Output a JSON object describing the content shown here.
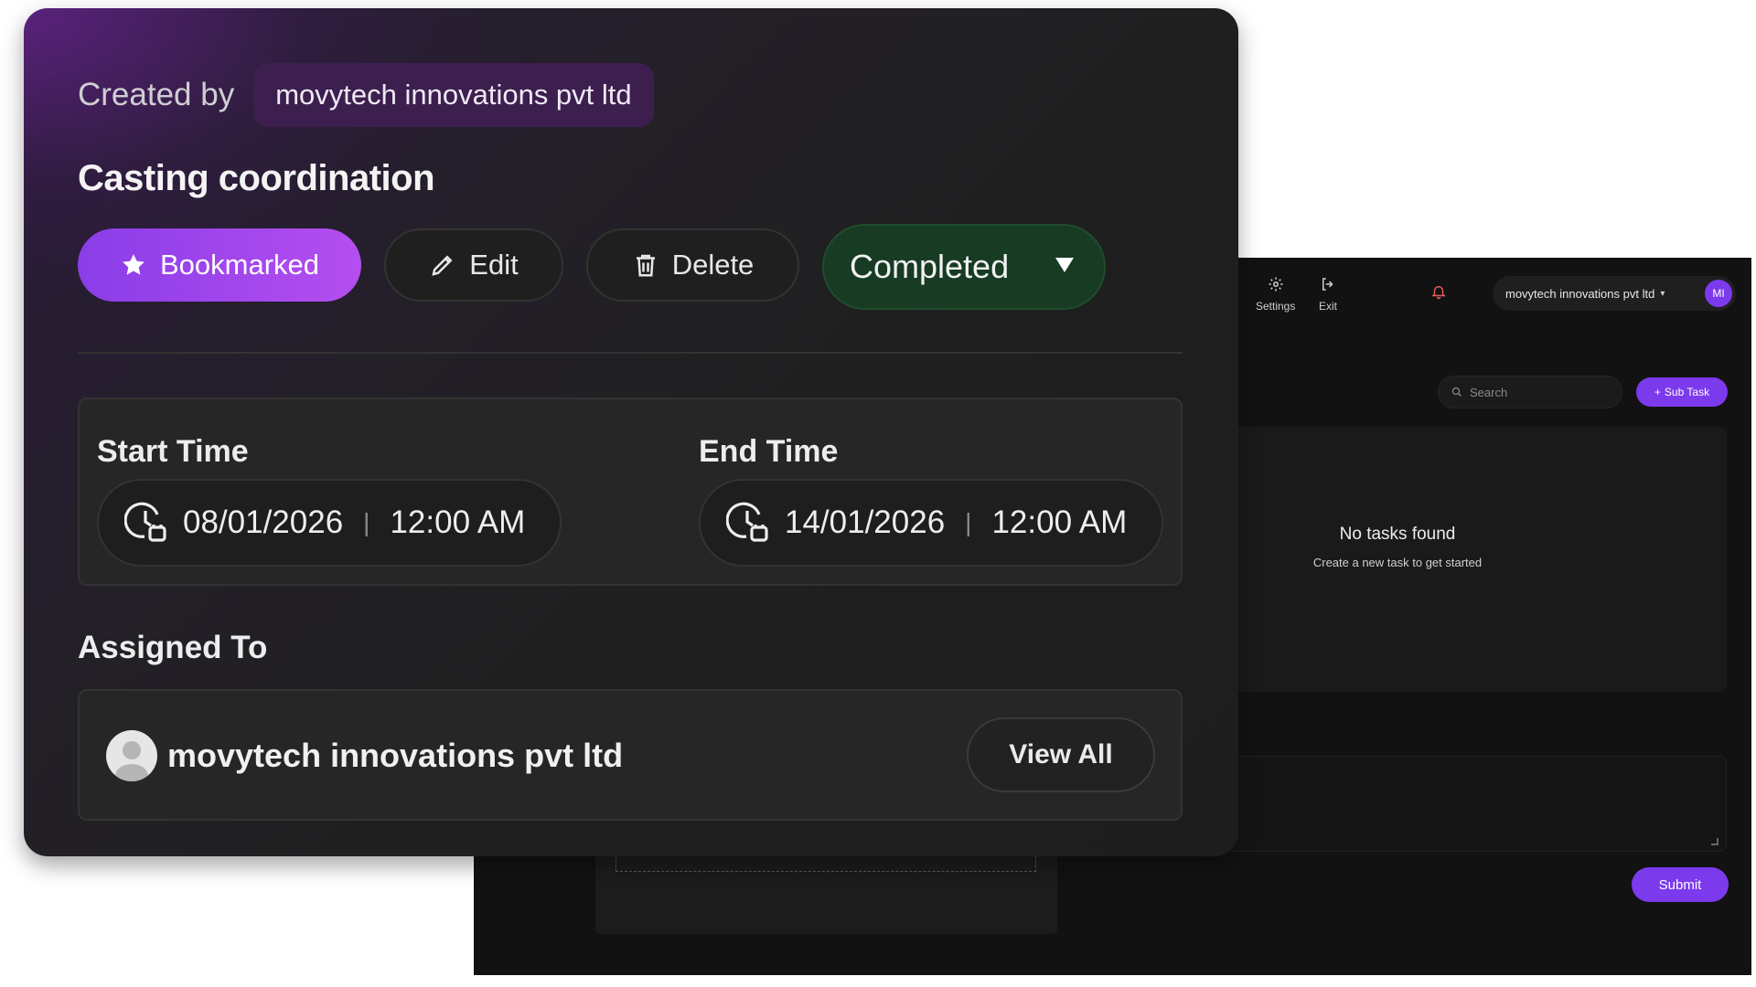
{
  "background": {
    "topbar": {
      "settings_label": "Settings",
      "exit_label": "Exit",
      "user_name": "movytech innovations pvt ltd",
      "user_initials": "MI"
    },
    "search_placeholder": "Search",
    "subtask_button": "Sub Task",
    "empty_state": {
      "title": "No tasks found",
      "subtitle": "Create a new task to get started"
    },
    "submit_button": "Submit",
    "accent_color": "#7c3aed"
  },
  "task": {
    "created_by_label": "Created by",
    "creator": "movytech innovations pvt ltd",
    "title": "Casting coordination",
    "actions": {
      "bookmark": "Bookmarked",
      "edit": "Edit",
      "delete": "Delete"
    },
    "status": "Completed",
    "start": {
      "label": "Start Time",
      "date": "08/01/2026",
      "time": "12:00 AM"
    },
    "end": {
      "label": "End Time",
      "date": "14/01/2026",
      "time": "12:00 AM"
    },
    "assigned_heading": "Assigned To",
    "assignee": "movytech innovations pvt ltd",
    "view_all": "View All",
    "colors": {
      "bookmark_gradient_start": "#8a3de8",
      "bookmark_gradient_end": "#b54ef0",
      "status_bg": "#173b23"
    }
  },
  "icons": [
    "star-icon",
    "pencil-icon",
    "trash-icon",
    "caret-down-icon",
    "clock-calendar-icon",
    "user-avatar-icon",
    "gear-icon",
    "exit-icon",
    "bell-icon",
    "search-icon",
    "plus-icon"
  ]
}
